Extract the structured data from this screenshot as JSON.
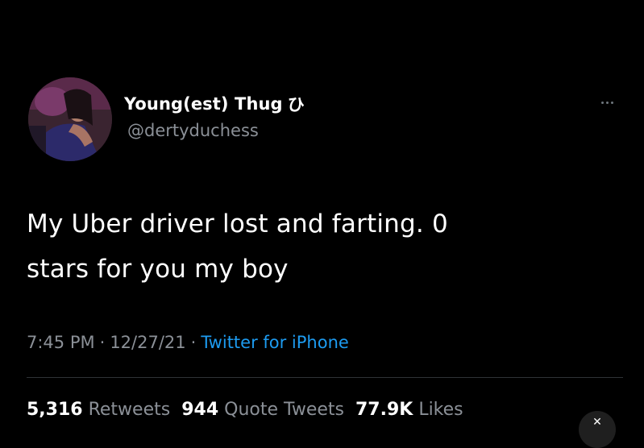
{
  "author": {
    "display_name": "Young(est) Thug",
    "name_symbol": "ひ",
    "handle": "@dertyduchess",
    "avatar_icon": "profile-photo"
  },
  "tweet": {
    "text_line1": "My Uber driver lost and farting. 0",
    "text_line2": "stars for you my boy"
  },
  "meta": {
    "time": "7:45 PM",
    "separator": "·",
    "date": "12/27/21",
    "source": "Twitter for iPhone"
  },
  "stats": {
    "retweets_count": "5,316",
    "retweets_label": "Retweets",
    "quotes_count": "944",
    "quotes_label": "Quote Tweets",
    "likes_count": "77.9K",
    "likes_label": "Likes"
  },
  "icons": {
    "more": "more-horizontal-icon",
    "close": "close-icon"
  },
  "colors": {
    "background": "#000000",
    "primary_text": "#ffffff",
    "secondary_text": "#8b9097",
    "link": "#1d9bf0"
  }
}
